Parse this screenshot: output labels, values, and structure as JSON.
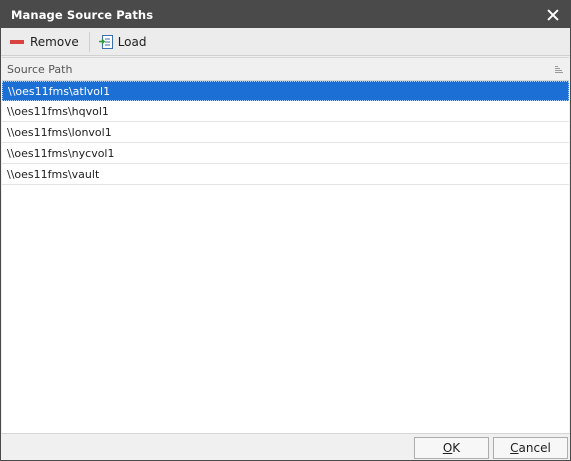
{
  "window": {
    "title": "Manage Source Paths"
  },
  "toolbar": {
    "remove_label": "Remove",
    "load_label": "Load",
    "remove_icon": "minus-bar-icon",
    "load_icon": "import-file-icon"
  },
  "grid": {
    "column_header": "Source Path",
    "rows": [
      {
        "path": "\\\\oes11fms\\atlvol1",
        "selected": true
      },
      {
        "path": "\\\\oes11fms\\hqvol1",
        "selected": false
      },
      {
        "path": "\\\\oes11fms\\lonvol1",
        "selected": false
      },
      {
        "path": "\\\\oes11fms\\nycvol1",
        "selected": false
      },
      {
        "path": "\\\\oes11fms\\vault",
        "selected": false
      }
    ]
  },
  "footer": {
    "ok_first": "O",
    "ok_rest": "K",
    "cancel_first": "C",
    "cancel_rest": "ancel"
  },
  "colors": {
    "titlebar": "#4a4a4a",
    "selection": "#1c6fd4",
    "remove_icon": "#d9423f"
  }
}
